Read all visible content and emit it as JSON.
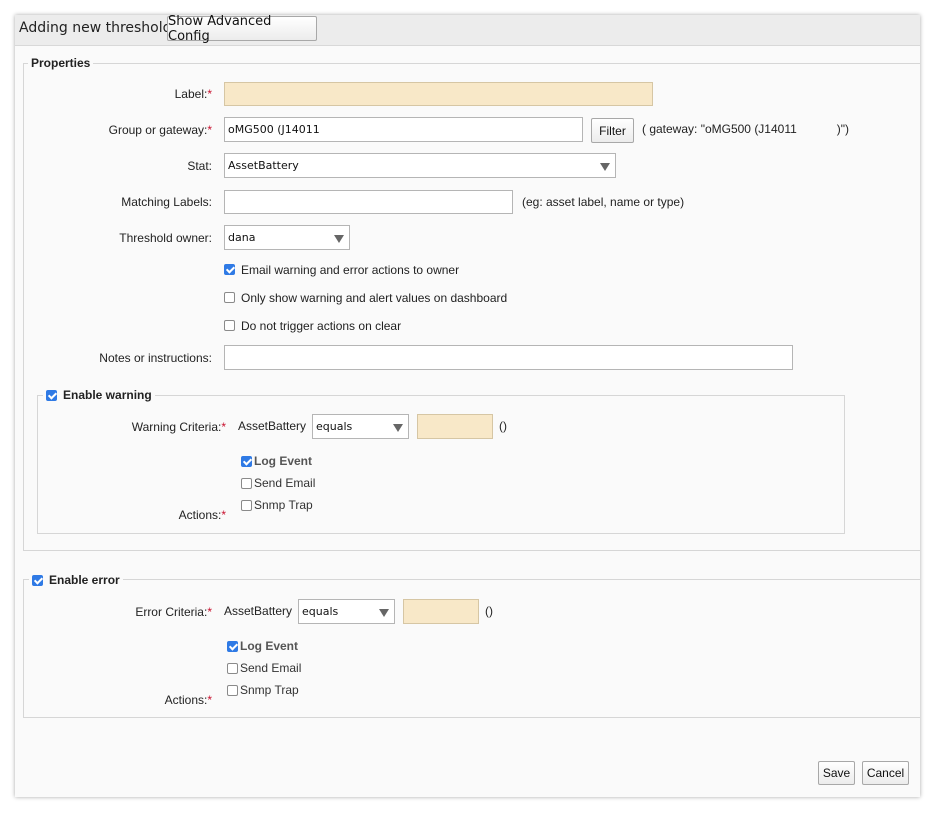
{
  "dialog": {
    "title": "Adding new threshold",
    "advanced_button": "Show Advanced Config"
  },
  "properties": {
    "legend": "Properties",
    "label": {
      "text": "Label:",
      "value": ""
    },
    "group": {
      "text": "Group or gateway:",
      "value": "oMG500 (J14011",
      "filter_button": "Filter",
      "hint": "( gateway: \"oMG500 (J14011",
      "hint_end": ")\")"
    },
    "stat": {
      "text": "Stat:",
      "value": "AssetBattery"
    },
    "matching": {
      "text": "Matching Labels:",
      "value": "",
      "hint": "(eg: asset label, name or type)"
    },
    "owner": {
      "text": "Threshold owner:",
      "value": "dana"
    },
    "options": [
      {
        "label": "Email warning and error actions to owner",
        "checked": true
      },
      {
        "label": "Only show warning and alert values on dashboard",
        "checked": false
      },
      {
        "label": "Do not trigger actions on clear",
        "checked": false
      }
    ],
    "notes": {
      "text": "Notes or instructions:",
      "value": ""
    }
  },
  "warning": {
    "legend": "Enable warning",
    "enabled": true,
    "criteria_label": "Warning Criteria:",
    "stat": "AssetBattery",
    "operator": "equals",
    "value": "",
    "unit": "()",
    "actions_label": "Actions:",
    "actions": [
      {
        "label": "Log Event",
        "checked": true
      },
      {
        "label": "Send Email",
        "checked": false
      },
      {
        "label": "Snmp Trap",
        "checked": false
      }
    ]
  },
  "error": {
    "legend": "Enable error",
    "enabled": true,
    "criteria_label": "Error Criteria:",
    "stat": "AssetBattery",
    "operator": "equals",
    "value": "",
    "unit": "()",
    "actions_label": "Actions:",
    "actions": [
      {
        "label": "Log Event",
        "checked": true
      },
      {
        "label": "Send Email",
        "checked": false
      },
      {
        "label": "Snmp Trap",
        "checked": false
      }
    ]
  },
  "footer": {
    "save": "Save",
    "cancel": "Cancel"
  },
  "colors": {
    "required_field": "#f8e8c8",
    "checkbox_on": "#2f7ae5",
    "required_star": "#c8102e"
  }
}
